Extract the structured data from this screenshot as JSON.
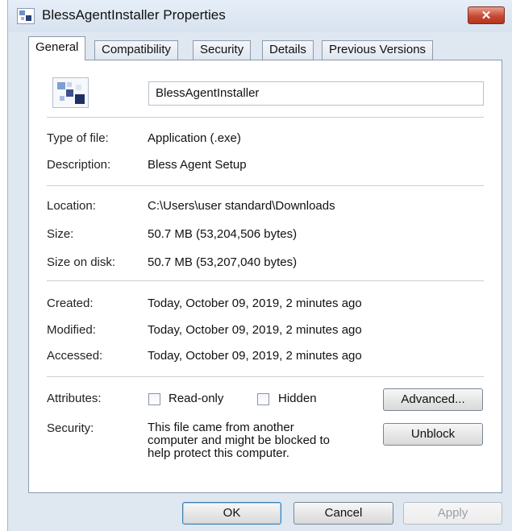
{
  "window": {
    "title": "BlessAgentInstaller Properties",
    "close_glyph": "✕"
  },
  "tabs": [
    {
      "label": "General",
      "active": true
    },
    {
      "label": "Compatibility",
      "active": false
    },
    {
      "label": "Security",
      "active": false
    },
    {
      "label": "Details",
      "active": false
    },
    {
      "label": "Previous Versions",
      "active": false
    }
  ],
  "general": {
    "file_name": "BlessAgentInstaller",
    "type_label": "Type of file:",
    "type_value": "Application (.exe)",
    "description_label": "Description:",
    "description_value": "Bless Agent Setup",
    "location_label": "Location:",
    "location_value": "C:\\Users\\user standard\\Downloads",
    "size_label": "Size:",
    "size_value": "50.7 MB (53,204,506 bytes)",
    "size_on_disk_label": "Size on disk:",
    "size_on_disk_value": "50.7 MB (53,207,040 bytes)",
    "created_label": "Created:",
    "created_value": "Today, October 09, 2019, 2 minutes ago",
    "modified_label": "Modified:",
    "modified_value": "Today, October 09, 2019, 2 minutes ago",
    "accessed_label": "Accessed:",
    "accessed_value": "Today, October 09, 2019, 2 minutes ago",
    "attributes_label": "Attributes:",
    "readonly_label": "Read-only",
    "readonly_checked": false,
    "hidden_label": "Hidden",
    "hidden_checked": false,
    "advanced_button": "Advanced...",
    "security_label": "Security:",
    "security_line1": "This file came from another",
    "security_line2": "computer and might be blocked to",
    "security_line3": "help protect this computer.",
    "unblock_button": "Unblock"
  },
  "footer": {
    "ok_button": "OK",
    "cancel_button": "Cancel",
    "apply_button": "Apply"
  },
  "colors": {
    "window_frame": "#dfe7f1",
    "close_button": "#c64a33",
    "default_button_border": "#3c7fb1"
  },
  "icons": {
    "title_icon": "application-icon",
    "file_icon": "application-file-icon"
  }
}
